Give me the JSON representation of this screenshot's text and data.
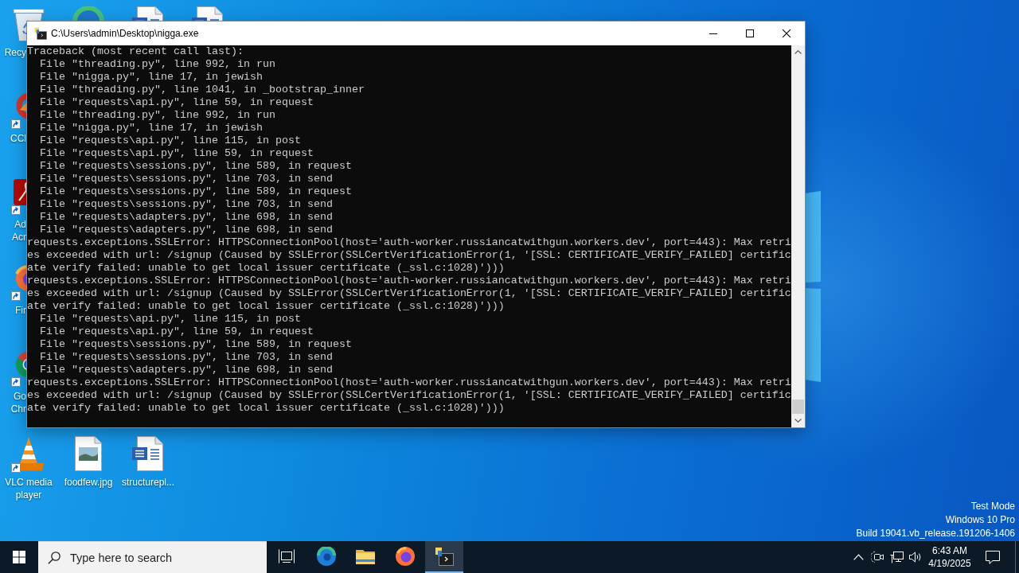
{
  "desktop": {
    "icons": [
      {
        "kind": "recycle-bin",
        "label": "Recy",
        "shortcut": false
      },
      {
        "kind": "edge"
      },
      {
        "kind": "word-doc"
      },
      {
        "kind": "word-doc"
      },
      {
        "kind": "cleaner",
        "label": "CCl",
        "shortcut": true
      },
      {
        "kind": "pdf-reader",
        "label": "Ad Acr",
        "shortcut": true
      },
      {
        "kind": "firefox",
        "label": "Fir",
        "shortcut": true
      },
      {
        "kind": "chrome",
        "label": "Go Chr",
        "shortcut": true
      },
      {
        "kind": "vlc",
        "label": "VLC media player",
        "shortcut": true
      },
      {
        "kind": "image",
        "label": "foodfew.jpg",
        "shortcut": false
      },
      {
        "kind": "word-doc",
        "label": "structurepl...",
        "shortcut": false
      }
    ],
    "system_info": [
      "Test Mode",
      "Windows 10 Pro",
      "Build 19041.vb_release.191206-1406"
    ]
  },
  "console_window": {
    "title": "C:\\Users\\admin\\Desktop\\nigga.exe",
    "lines": [
      "Traceback (most recent call last):",
      "  File \"threading.py\", line 992, in run",
      "  File \"nigga.py\", line 17, in jewish",
      "  File \"threading.py\", line 1041, in _bootstrap_inner",
      "  File \"requests\\api.py\", line 59, in request",
      "  File \"threading.py\", line 992, in run",
      "  File \"nigga.py\", line 17, in jewish",
      "  File \"requests\\api.py\", line 115, in post",
      "  File \"requests\\api.py\", line 59, in request",
      "  File \"requests\\sessions.py\", line 589, in request",
      "  File \"requests\\sessions.py\", line 703, in send",
      "  File \"requests\\sessions.py\", line 589, in request",
      "  File \"requests\\sessions.py\", line 703, in send",
      "  File \"requests\\adapters.py\", line 698, in send",
      "  File \"requests\\adapters.py\", line 698, in send",
      "requests.exceptions.SSLError: HTTPSConnectionPool(host='auth-worker.russiancatwithgun.workers.dev', port=443): Max retri",
      "es exceeded with url: /signup (Caused by SSLError(SSLCertVerificationError(1, '[SSL: CERTIFICATE_VERIFY_FAILED] certific",
      "ate verify failed: unable to get local issuer certificate (_ssl.c:1028)')))",
      "requests.exceptions.SSLError: HTTPSConnectionPool(host='auth-worker.russiancatwithgun.workers.dev', port=443): Max retri",
      "es exceeded with url: /signup (Caused by SSLError(SSLCertVerificationError(1, '[SSL: CERTIFICATE_VERIFY_FAILED] certific",
      "ate verify failed: unable to get local issuer certificate (_ssl.c:1028)')))",
      "  File \"requests\\api.py\", line 115, in post",
      "  File \"requests\\api.py\", line 59, in request",
      "  File \"requests\\sessions.py\", line 589, in request",
      "  File \"requests\\sessions.py\", line 703, in send",
      "  File \"requests\\adapters.py\", line 698, in send",
      "requests.exceptions.SSLError: HTTPSConnectionPool(host='auth-worker.russiancatwithgun.workers.dev', port=443): Max retri",
      "es exceeded with url: /signup (Caused by SSLError(SSLCertVerificationError(1, '[SSL: CERTIFICATE_VERIFY_FAILED] certific",
      "ate verify failed: unable to get local issuer certificate (_ssl.c:1028)')))"
    ]
  },
  "taskbar": {
    "search": {
      "placeholder": "Type here to search"
    },
    "apps": [
      {
        "kind": "task-view",
        "selected": false
      },
      {
        "kind": "edge",
        "selected": false
      },
      {
        "kind": "folder",
        "selected": false
      },
      {
        "kind": "firefox",
        "selected": false
      },
      {
        "kind": "console",
        "selected": true
      }
    ],
    "tray": [
      {
        "kind": "chevron"
      },
      {
        "kind": "meet"
      },
      {
        "kind": "network"
      },
      {
        "kind": "volume"
      }
    ],
    "clock": {
      "time": "6:43 AM",
      "date": "4/19/2025"
    }
  }
}
